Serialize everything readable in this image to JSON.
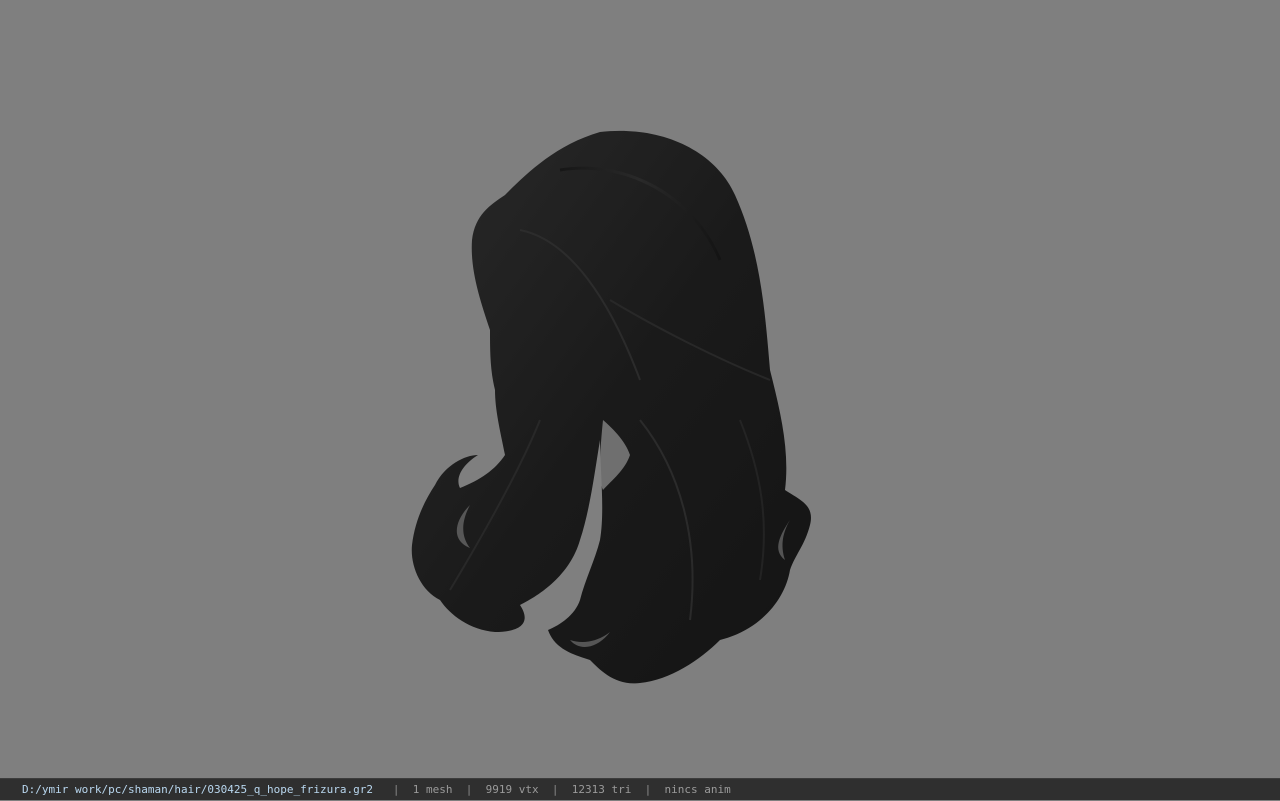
{
  "viewport": {
    "background_color": "#7f7f7f",
    "model": {
      "name": "hair-model",
      "color": "#1c1c1c"
    }
  },
  "status_bar": {
    "file_path": "D:/ymir work/pc/shaman/hair/030425_q_hope_frizura.gr2",
    "separator": "|",
    "mesh_count": "1 mesh",
    "vertex_count": "9919 vtx",
    "triangle_count": "12313 tri",
    "anim_status": "nincs anim",
    "background_color": "#2f2f2f",
    "path_color": "#b8d6ee"
  }
}
